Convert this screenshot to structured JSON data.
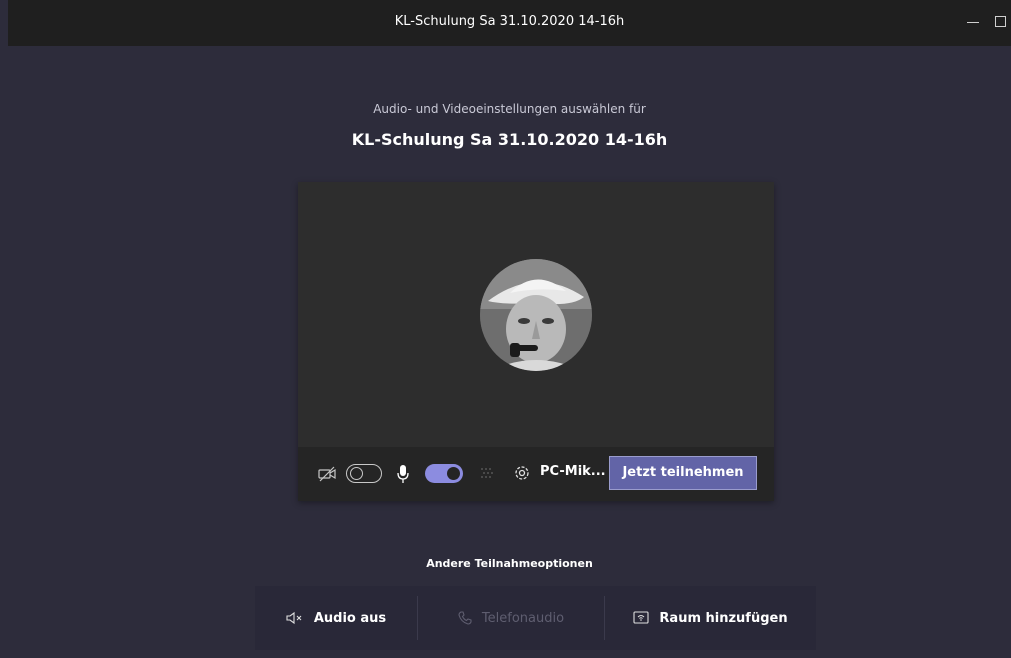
{
  "window": {
    "title": "KL-Schulung Sa 31.10.2020 14-16h",
    "controls": [
      "minimize-icon",
      "maximize-icon"
    ]
  },
  "prejoin": {
    "subtitle": "Audio- und Videoeinstellungen auswählen für",
    "meeting_name": "KL-Schulung Sa 31.10.2020 14-16h"
  },
  "controls": {
    "camera_on": false,
    "microphone_on": true,
    "device_label": "PC-Mik...",
    "join_label": "Jetzt teilnehmen"
  },
  "other": {
    "heading": "Andere Teilnahmeoptionen",
    "options": [
      {
        "label": "Audio aus",
        "icon": "speaker-muted-icon",
        "enabled": true
      },
      {
        "label": "Telefonaudio",
        "icon": "phone-icon",
        "enabled": false
      },
      {
        "label": "Raum hinzufügen",
        "icon": "room-device-icon",
        "enabled": true
      }
    ]
  },
  "colors": {
    "background": "#2d2c3b",
    "accent": "#6264a7",
    "toggle_on": "#8c8ce0"
  }
}
